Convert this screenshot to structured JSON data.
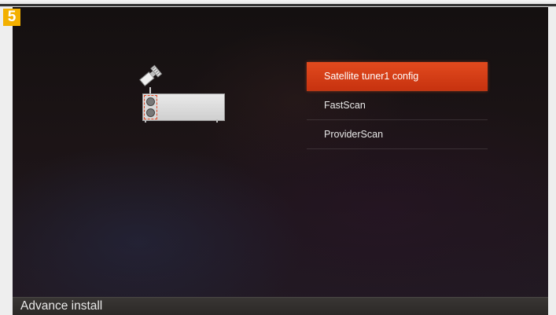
{
  "step_badge": "5",
  "icons": [
    "satellite-icon",
    "tuner-box-icon"
  ],
  "menu": {
    "items": [
      {
        "label": "Satellite tuner1 config",
        "selected": true
      },
      {
        "label": "FastScan",
        "selected": false
      },
      {
        "label": "ProviderScan",
        "selected": false
      }
    ]
  },
  "footer": {
    "title": "Advance install"
  },
  "colors": {
    "accent": "#d63d14",
    "badge": "#f3b000",
    "background": "#1a1314"
  }
}
